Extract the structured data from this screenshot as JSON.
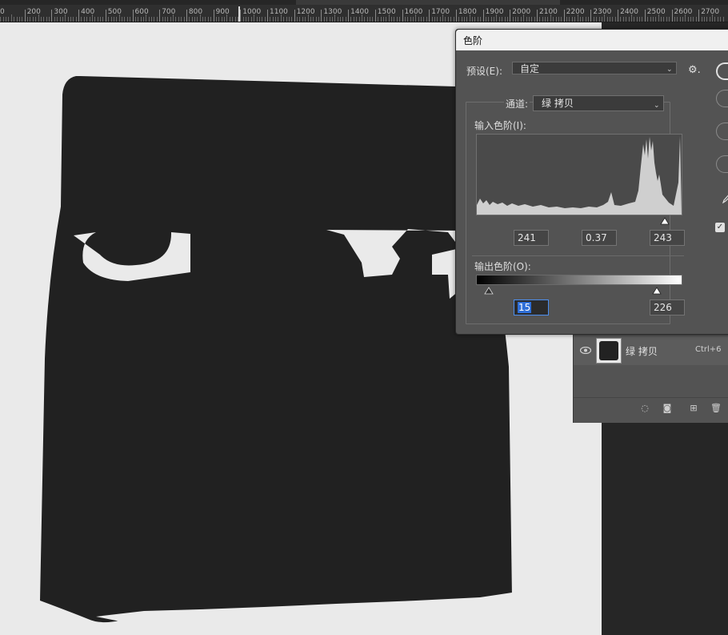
{
  "ruler": {
    "labels": [
      "0",
      "200",
      "300",
      "400",
      "500",
      "600",
      "700",
      "800",
      "900",
      "1000",
      "1100",
      "1200",
      "1300",
      "1400",
      "1500",
      "1600",
      "1700",
      "1800",
      "1900",
      "2000",
      "2100",
      "2200",
      "2300",
      "2400",
      "2500",
      "2600",
      "2700"
    ]
  },
  "dialog": {
    "title": "色阶",
    "preset_label": "预设(E):",
    "preset_value": "自定",
    "channel_label": "通道:",
    "channel_value": "绿 拷贝",
    "input_label": "输入色阶(I):",
    "input_values": {
      "black": "241",
      "gamma": "0.37",
      "white": "243"
    },
    "output_label": "输出色阶(O):",
    "output_values": {
      "black": "15",
      "white": "226"
    }
  },
  "layers": {
    "layer_name": "绿 拷贝",
    "layer_shortcut": "Ctrl+6"
  },
  "colors": {
    "canvas_bg": "#eaeaea",
    "image_dark": "#222222",
    "dialog_bg": "#535353",
    "accent": "#4c8ff0"
  },
  "icons": {
    "dialog_gear": "gear-icon",
    "select_chevron": "chevron-down-icon",
    "layer_visibility": "eye-icon",
    "footer": [
      "adjustment-icon",
      "mask-icon",
      "new-layer-icon",
      "trash-icon"
    ]
  }
}
